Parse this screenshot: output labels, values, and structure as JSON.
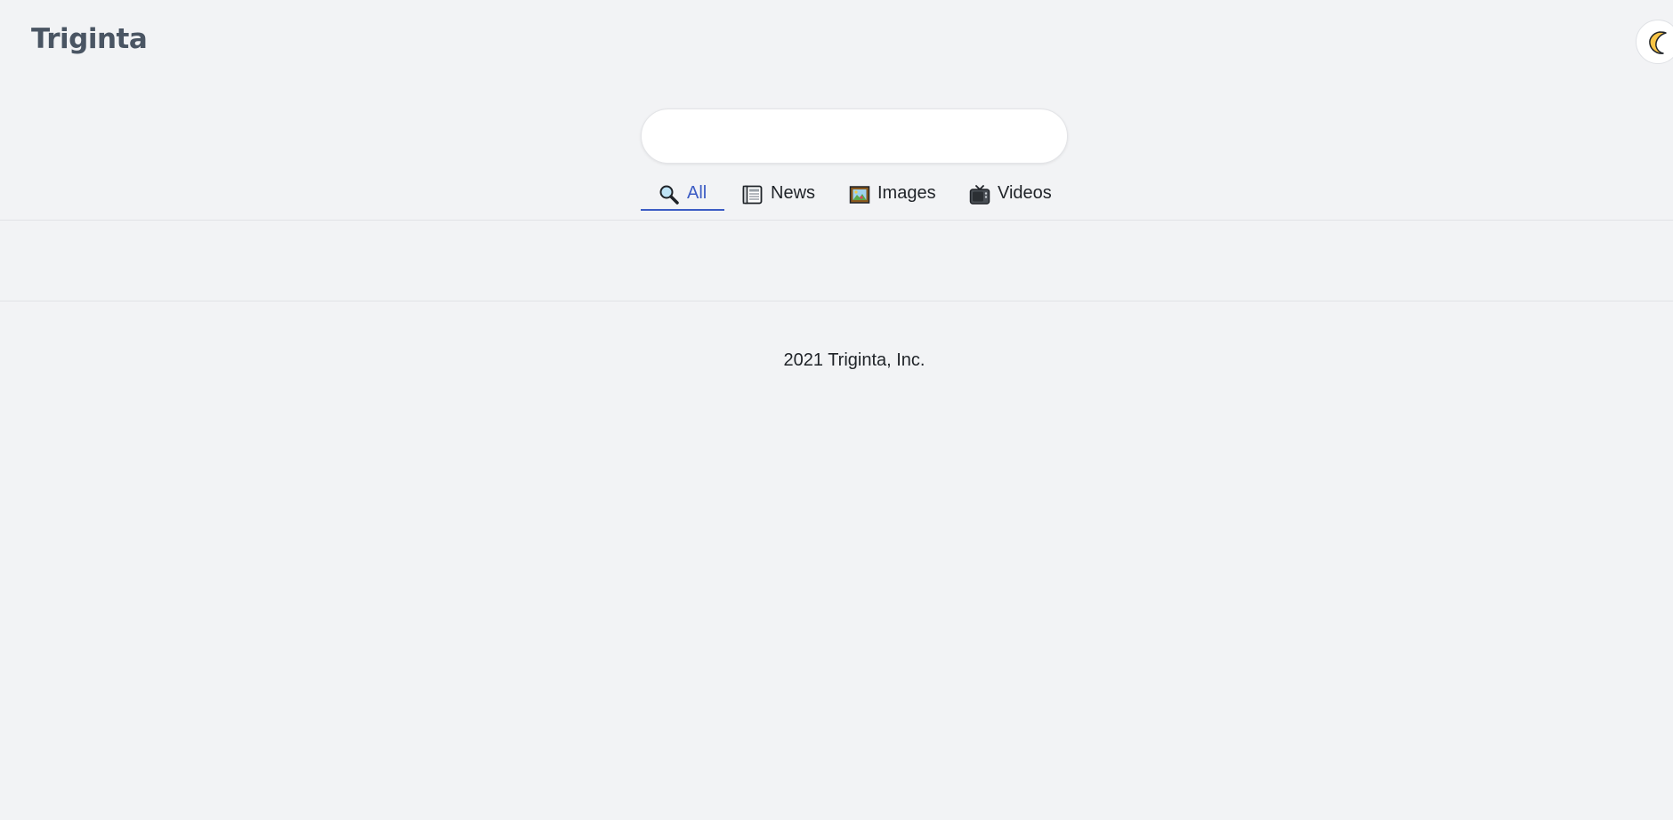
{
  "header": {
    "logo": "Triginta",
    "theme_toggle_icon": "crescent-moon-icon"
  },
  "search": {
    "value": "",
    "placeholder": ""
  },
  "tabs": [
    {
      "label": "All",
      "icon": "magnifying-glass-icon",
      "active": true
    },
    {
      "label": "News",
      "icon": "newspaper-icon",
      "active": false
    },
    {
      "label": "Images",
      "icon": "framed-picture-icon",
      "active": false
    },
    {
      "label": "Videos",
      "icon": "television-icon",
      "active": false
    }
  ],
  "footer": {
    "text": "2021 Triginta, Inc."
  },
  "colors": {
    "background": "#f2f3f5",
    "active_tab": "#3c5cc4",
    "logo": "#4a5563"
  }
}
